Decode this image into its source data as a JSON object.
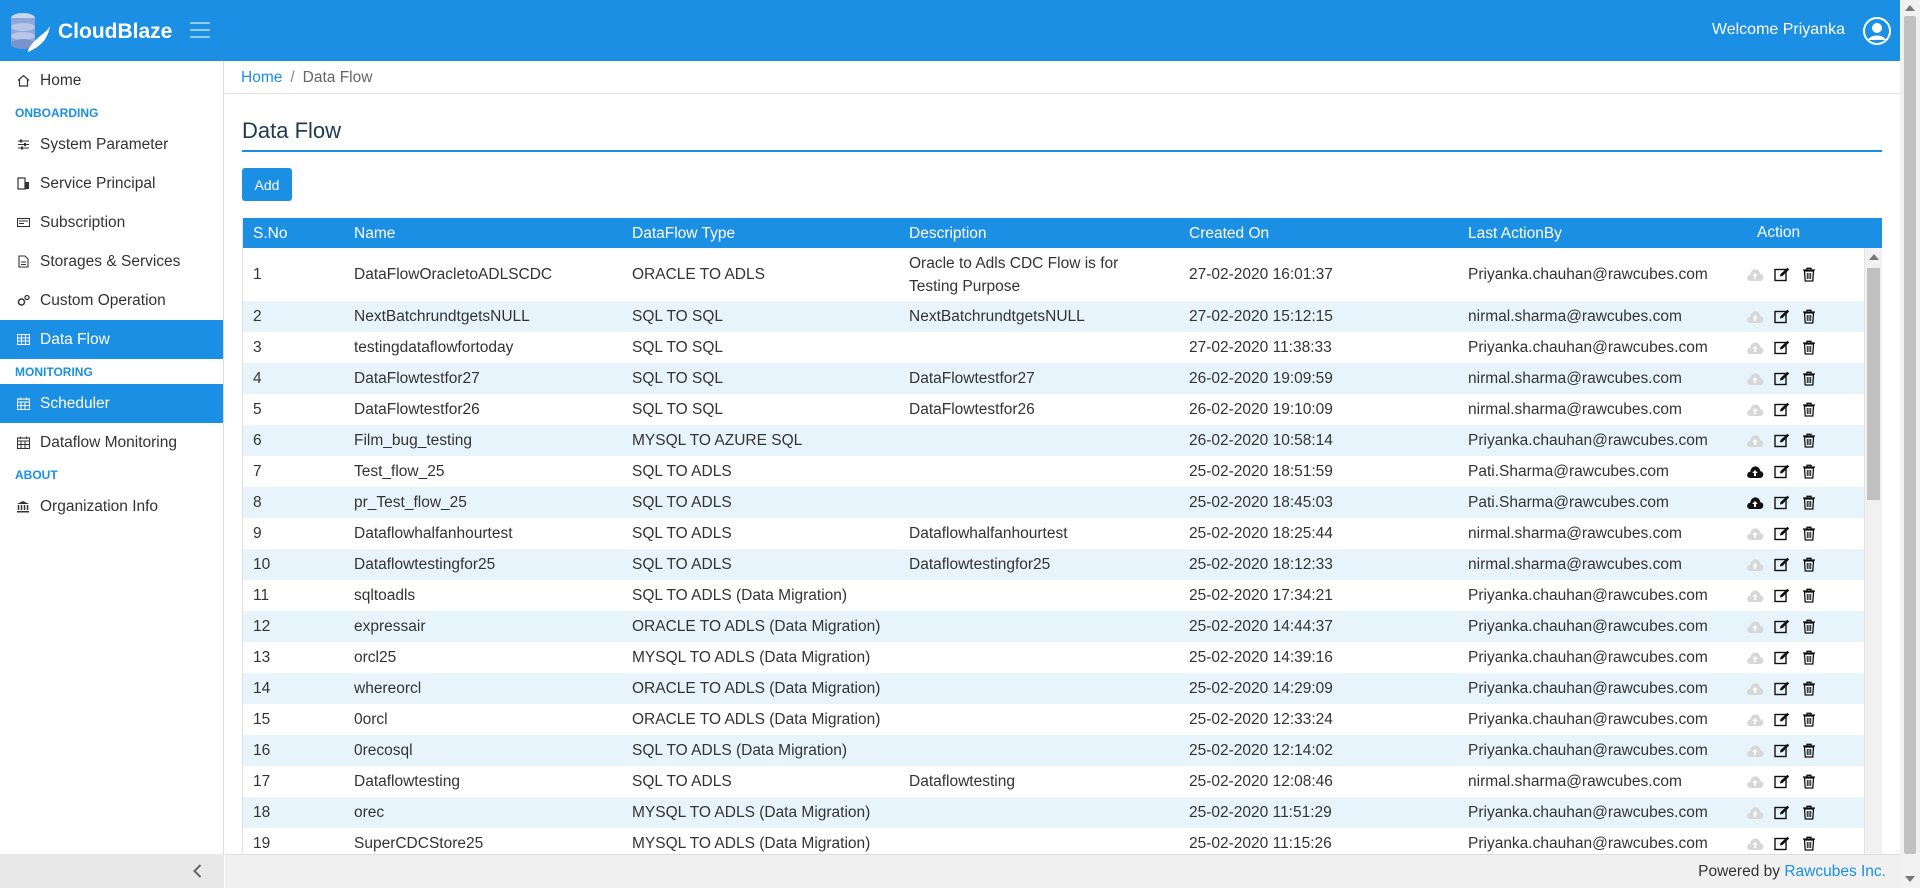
{
  "app": {
    "brand": "CloudBlaze",
    "welcome": "Welcome Priyanka",
    "accent_color": "#1a8fe3"
  },
  "sidebar": {
    "items": [
      {
        "label": "Home",
        "icon": "home-icon"
      },
      {
        "section": "ONBOARDING"
      },
      {
        "label": "System Parameter",
        "icon": "sliders-icon"
      },
      {
        "label": "Service Principal",
        "icon": "building-icon"
      },
      {
        "label": "Subscription",
        "icon": "card-icon"
      },
      {
        "label": "Storages & Services",
        "icon": "document-icon"
      },
      {
        "label": "Custom Operation",
        "icon": "gears-icon"
      },
      {
        "label": "Data Flow",
        "icon": "table-icon",
        "active": true
      },
      {
        "section": "MONITORING"
      },
      {
        "label": "Scheduler",
        "icon": "calendar-icon",
        "active": true
      },
      {
        "label": "Dataflow Monitoring",
        "icon": "calendar-icon"
      },
      {
        "section": "ABOUT"
      },
      {
        "label": "Organization Info",
        "icon": "bank-icon"
      }
    ]
  },
  "breadcrumb": {
    "home": "Home",
    "separator": "/",
    "current": "Data Flow"
  },
  "page": {
    "title": "Data Flow",
    "add_label": "Add"
  },
  "table": {
    "columns": [
      "S.No",
      "Name",
      "DataFlow Type",
      "Description",
      "Created On",
      "Last ActionBy",
      "Action"
    ],
    "rows": [
      {
        "sno": "1",
        "name": "DataFlowOracletoADLSCDC",
        "type": "ORACLE TO ADLS",
        "desc": "Oracle to Adls CDC Flow is for Testing Purpose",
        "created": "27-02-2020 16:01:37",
        "by": "Priyanka.chauhan@rawcubes.com",
        "upload_enabled": false
      },
      {
        "sno": "2",
        "name": "NextBatchrundtgetsNULL",
        "type": "SQL TO SQL",
        "desc": "NextBatchrundtgetsNULL",
        "created": "27-02-2020 15:12:15",
        "by": "nirmal.sharma@rawcubes.com",
        "upload_enabled": false
      },
      {
        "sno": "3",
        "name": "testingdataflowfortoday",
        "type": "SQL TO SQL",
        "desc": "",
        "created": "27-02-2020 11:38:33",
        "by": "Priyanka.chauhan@rawcubes.com",
        "upload_enabled": false
      },
      {
        "sno": "4",
        "name": "DataFlowtestfor27",
        "type": "SQL TO SQL",
        "desc": "DataFlowtestfor27",
        "created": "26-02-2020 19:09:59",
        "by": "nirmal.sharma@rawcubes.com",
        "upload_enabled": false
      },
      {
        "sno": "5",
        "name": "DataFlowtestfor26",
        "type": "SQL TO SQL",
        "desc": "DataFlowtestfor26",
        "created": "26-02-2020 19:10:09",
        "by": "nirmal.sharma@rawcubes.com",
        "upload_enabled": false
      },
      {
        "sno": "6",
        "name": "Film_bug_testing",
        "type": "MYSQL TO AZURE SQL",
        "desc": "",
        "created": "26-02-2020 10:58:14",
        "by": "Priyanka.chauhan@rawcubes.com",
        "upload_enabled": false
      },
      {
        "sno": "7",
        "name": "Test_flow_25",
        "type": "SQL TO ADLS",
        "desc": "",
        "created": "25-02-2020 18:51:59",
        "by": "Pati.Sharma@rawcubes.com",
        "upload_enabled": true
      },
      {
        "sno": "8",
        "name": "pr_Test_flow_25",
        "type": "SQL TO ADLS",
        "desc": "",
        "created": "25-02-2020 18:45:03",
        "by": "Pati.Sharma@rawcubes.com",
        "upload_enabled": true
      },
      {
        "sno": "9",
        "name": "Dataflowhalfanhourtest",
        "type": "SQL TO ADLS",
        "desc": "Dataflowhalfanhourtest",
        "created": "25-02-2020 18:25:44",
        "by": "nirmal.sharma@rawcubes.com",
        "upload_enabled": false
      },
      {
        "sno": "10",
        "name": "Dataflowtestingfor25",
        "type": "SQL TO ADLS",
        "desc": "Dataflowtestingfor25",
        "created": "25-02-2020 18:12:33",
        "by": "nirmal.sharma@rawcubes.com",
        "upload_enabled": false
      },
      {
        "sno": "11",
        "name": "sqltoadls",
        "type": "SQL TO ADLS (Data Migration)",
        "desc": "",
        "created": "25-02-2020 17:34:21",
        "by": "Priyanka.chauhan@rawcubes.com",
        "upload_enabled": false
      },
      {
        "sno": "12",
        "name": "expressair",
        "type": "ORACLE TO ADLS (Data Migration)",
        "desc": "",
        "created": "25-02-2020 14:44:37",
        "by": "Priyanka.chauhan@rawcubes.com",
        "upload_enabled": false
      },
      {
        "sno": "13",
        "name": "orcl25",
        "type": "MYSQL TO ADLS (Data Migration)",
        "desc": "",
        "created": "25-02-2020 14:39:16",
        "by": "Priyanka.chauhan@rawcubes.com",
        "upload_enabled": false
      },
      {
        "sno": "14",
        "name": "whereorcl",
        "type": "ORACLE TO ADLS (Data Migration)",
        "desc": "",
        "created": "25-02-2020 14:29:09",
        "by": "Priyanka.chauhan@rawcubes.com",
        "upload_enabled": false
      },
      {
        "sno": "15",
        "name": "0orcl",
        "type": "ORACLE TO ADLS (Data Migration)",
        "desc": "",
        "created": "25-02-2020 12:33:24",
        "by": "Priyanka.chauhan@rawcubes.com",
        "upload_enabled": false
      },
      {
        "sno": "16",
        "name": "0recosql",
        "type": "SQL TO ADLS (Data Migration)",
        "desc": "",
        "created": "25-02-2020 12:14:02",
        "by": "Priyanka.chauhan@rawcubes.com",
        "upload_enabled": false
      },
      {
        "sno": "17",
        "name": "Dataflowtesting",
        "type": "SQL TO ADLS",
        "desc": "Dataflowtesting",
        "created": "25-02-2020 12:08:46",
        "by": "nirmal.sharma@rawcubes.com",
        "upload_enabled": false
      },
      {
        "sno": "18",
        "name": "orec",
        "type": "MYSQL TO ADLS (Data Migration)",
        "desc": "",
        "created": "25-02-2020 11:51:29",
        "by": "Priyanka.chauhan@rawcubes.com",
        "upload_enabled": false
      },
      {
        "sno": "19",
        "name": "SuperCDCStore25",
        "type": "MYSQL TO ADLS (Data Migration)",
        "desc": "",
        "created": "25-02-2020 11:15:26",
        "by": "Priyanka.chauhan@rawcubes.com",
        "upload_enabled": false
      }
    ]
  },
  "footer": {
    "powered_by": "Powered by",
    "company": "Rawcubes Inc."
  }
}
